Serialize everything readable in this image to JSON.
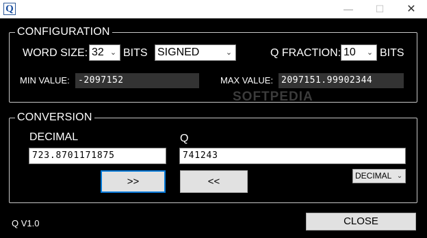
{
  "window": {
    "icon_letter": "Q",
    "controls": {
      "minimize": "—",
      "maximize": "☐",
      "close": "✕"
    }
  },
  "configuration": {
    "title": "CONFIGURATION",
    "word_size_label": "WORD SIZE:",
    "word_size_value": "32",
    "bits_label": "BITS",
    "signedness_value": "SIGNED",
    "q_fraction_label": "Q FRACTION:",
    "q_fraction_value": "10",
    "q_bits_label": "BITS",
    "min_label": "MIN VALUE:",
    "min_value": "-2097152",
    "max_label": "MAX VALUE:",
    "max_value": "2097151.99902344"
  },
  "conversion": {
    "title": "CONVERSION",
    "decimal_label": "DECIMAL",
    "decimal_value": "723.8701171875",
    "q_label": "Q",
    "q_value": "741243",
    "to_q_button": ">>",
    "to_decimal_button": "<<",
    "format_value": "DECIMAL"
  },
  "footer": {
    "version": "Q V1.0",
    "close_button": "CLOSE"
  },
  "watermark": "SOFTPEDIA"
}
